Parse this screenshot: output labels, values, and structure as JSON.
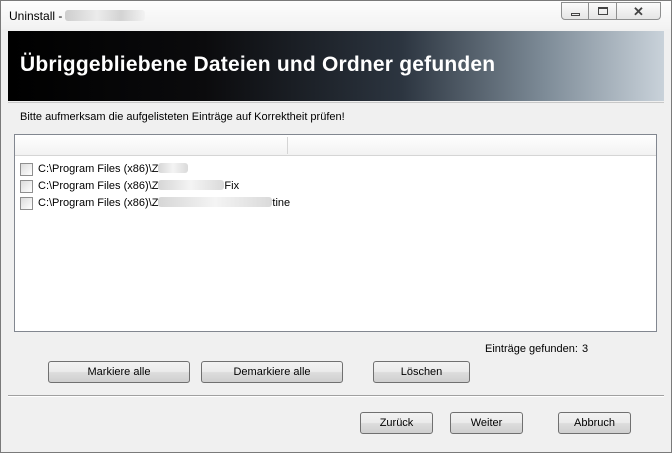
{
  "window": {
    "title": "Uninstall - ",
    "minimize_label": "",
    "maximize_label": "",
    "close_label": "✕"
  },
  "banner": {
    "title": "Übriggebliebene Dateien und Ordner gefunden"
  },
  "hint": "Bitte aufmerksam die aufgelisteten Einträge auf Korrektheit prüfen!",
  "list": {
    "columns": [
      "",
      ""
    ],
    "rows": [
      {
        "prefix": "C:\\Program Files (x86)\\Z",
        "suffix": "",
        "checked": false
      },
      {
        "prefix": "C:\\Program Files (x86)\\Z",
        "suffix": "Fix",
        "checked": false
      },
      {
        "prefix": "C:\\Program Files (x86)\\Z",
        "suffix": "tine",
        "checked": false
      }
    ]
  },
  "count": {
    "label": "Einträge gefunden:",
    "value": "3"
  },
  "buttons": {
    "mark_all": "Markiere alle",
    "unmark_all": "Demarkiere alle",
    "delete": "Löschen",
    "back": "Zurück",
    "next": "Weiter",
    "cancel": "Abbruch"
  }
}
